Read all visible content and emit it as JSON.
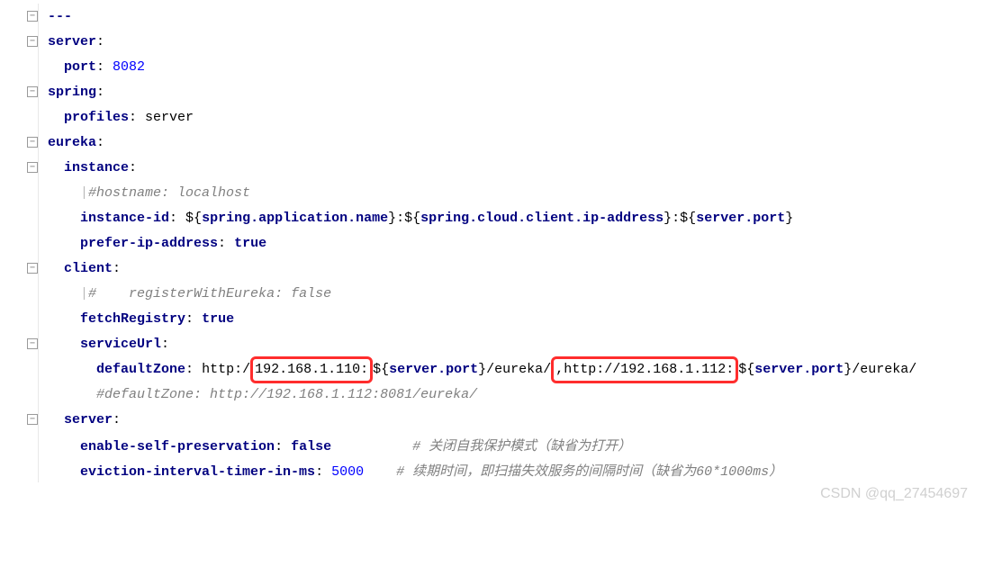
{
  "line01_sep": "---",
  "l02_key": "server",
  "l03_key": "port",
  "l03_val": "8082",
  "l04_key": "spring",
  "l05_key": "profiles",
  "l05_val": "server",
  "l06_key": "eureka",
  "l07_key": "instance",
  "l08_cmt": "#hostname: localhost",
  "l09_key": "instance-id",
  "l09_var1": "spring.application.name",
  "l09_var2": "spring.cloud.client.ip-address",
  "l09_var3": "server.port",
  "l10_key": "prefer-ip-address",
  "l10_val": "true",
  "l11_key": "client",
  "l12_cmt": "#    registerWithEureka: false",
  "l13_key": "fetchRegistry",
  "l13_val": "true",
  "l14_key": "serviceUrl",
  "l15_key": "defaultZone",
  "l15_left": "http:/",
  "l15_ip1": "192.168.1.110",
  "l15_mid1": "${",
  "l15_var1": "server.port",
  "l15_mid2": "}/eureka",
  "l15_ip2": ",http://192.168.1.112",
  "l15_var2": "server.port",
  "l15_end": "}/eureka/",
  "l16_cmt": "#defaultZone: http://192.168.1.112:8081/eureka/",
  "l17_key": "server",
  "l18_key": "enable-self-preservation",
  "l18_val": "false",
  "l18_cmt": "# 关闭自我保护模式（缺省为打开）",
  "l19_key": "eviction-interval-timer-in-ms",
  "l19_val": "5000",
  "l19_cmt": "# 续期时间，即扫描失效服务的间隔时间（缺省为60*1000ms）",
  "watermark": "CSDN @qq_27454697"
}
